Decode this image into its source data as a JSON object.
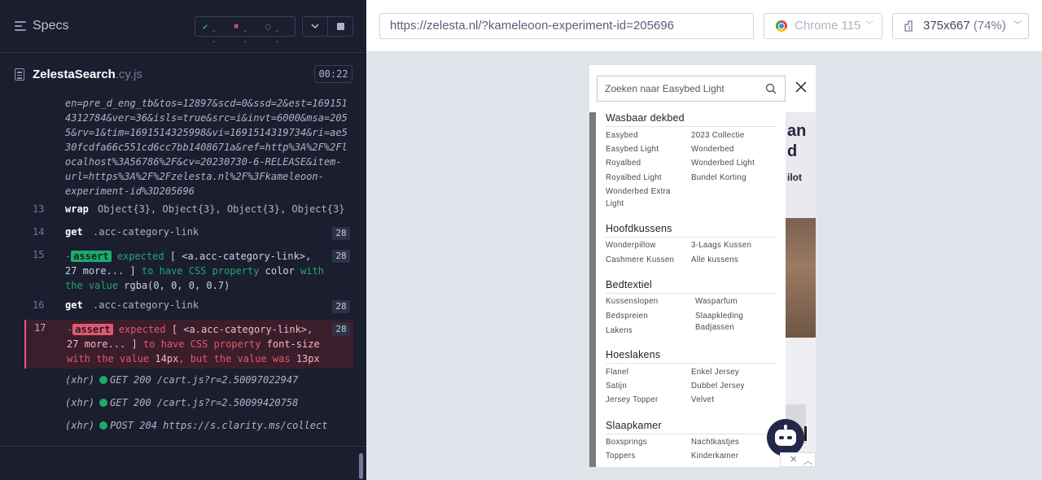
{
  "reporter": {
    "title": "Specs",
    "stats": {
      "passed": "--",
      "failed": "--",
      "pending": "--"
    },
    "spec_file": {
      "name": "ZelestaSearch",
      "ext": ".cy.js"
    },
    "duration": "00:22"
  },
  "log": {
    "url_lines": [
      "en=pre_d_eng_tb&tos=12897&scd=0&ssd=2&est=169151",
      "4312784&ver=36&isls=true&src=i&invt=6000&msa=205",
      "5&rv=1&tim=1691514325998&vi=1691514319734&ri=ae5",
      "30fcdfa66c551cd6cc7bb1408671a&ref=http%3A%2F%2Fl",
      "ocalhost%3A56786%2F&cv=20230730-6-RELEASE&item-",
      "url=https%3A%2F%2Fzelesta.nl%2F%3Fkameleoon-",
      "experiment-id%3D205696"
    ],
    "commands": [
      {
        "num": "13",
        "name": "wrap",
        "message": "Object{3}, Object{3}, Object{3}, Object{3}"
      },
      {
        "num": "14",
        "name": "get",
        "message": ".acc-category-link",
        "badge": "28"
      },
      {
        "num": "15",
        "name": "-assert",
        "badge": "28",
        "parts": [
          "expected",
          "[ <a.acc-category-link>,",
          "27 more... ]",
          "to have CSS property",
          "color",
          "with",
          "the value",
          "rgba(0, 0, 0, 0.7)"
        ]
      },
      {
        "num": "16",
        "name": "get",
        "message": ".acc-category-link",
        "badge": "28"
      },
      {
        "num": "17",
        "name": "-assert",
        "badge": "28",
        "parts": [
          "expected",
          "[ <a.acc-category-link>,",
          "27 more... ]",
          "to have CSS property",
          "font-size",
          "with the value",
          "14px",
          ", but the value was",
          "13px"
        ]
      }
    ],
    "xhr": [
      {
        "prefix": "(xhr)",
        "text": "GET 200 /cart.js?r=2.50097022947"
      },
      {
        "prefix": "(xhr)",
        "text": "GET 200 /cart.js?r=2.50099420758"
      },
      {
        "prefix": "(xhr)",
        "text": "POST 204 https://s.clarity.ms/collect"
      }
    ]
  },
  "aut": {
    "url": "https://zelesta.nl/?kameleoon-experiment-id=205696",
    "browser": "Chrome 115",
    "viewport": "375x667",
    "scale": "(74%)"
  },
  "site": {
    "search_placeholder": "Zoeken naar Easybed Light",
    "banner": [
      "an",
      "d",
      "ilot"
    ],
    "categories": [
      {
        "title": "Wasbaar dekbed",
        "left": [
          "Easybed",
          "Easybed Light",
          "Royalbed",
          "Royalbed Light",
          "Wonderbed Extra",
          "Light"
        ],
        "right": [
          "2023 Collectie",
          "Wonderbed",
          "Wonderbed Light",
          "Bundel Korting"
        ]
      },
      {
        "title": "Hoofdkussens",
        "left": [
          "Wonderpillow",
          "Cashmere Kussen"
        ],
        "right": [
          "3-Laags Kussen",
          "Alle kussens"
        ]
      },
      {
        "title": "Bedtextiel",
        "left": [
          "Kussenslopen",
          "Bedspreien",
          "Lakens"
        ],
        "right": [
          "Wasparfum",
          "Slaapkleding",
          "Badjassen"
        ]
      },
      {
        "title": "Hoeslakens",
        "left": [
          "Flanel",
          "Satijn",
          "Jersey Topper"
        ],
        "right": [
          "Enkel Jersey",
          "Dubbel Jersey",
          "Velvet"
        ]
      },
      {
        "title": "Slaapkamer",
        "left": [
          "Boxsprings",
          "Toppers"
        ],
        "right": [
          "Nachtkastjes",
          "Kinderkamer"
        ]
      }
    ]
  },
  "colors": {
    "pass": "#1fa971",
    "fail": "#e45770",
    "panel": "#1b1e2e",
    "chat_bot": "#232848"
  }
}
